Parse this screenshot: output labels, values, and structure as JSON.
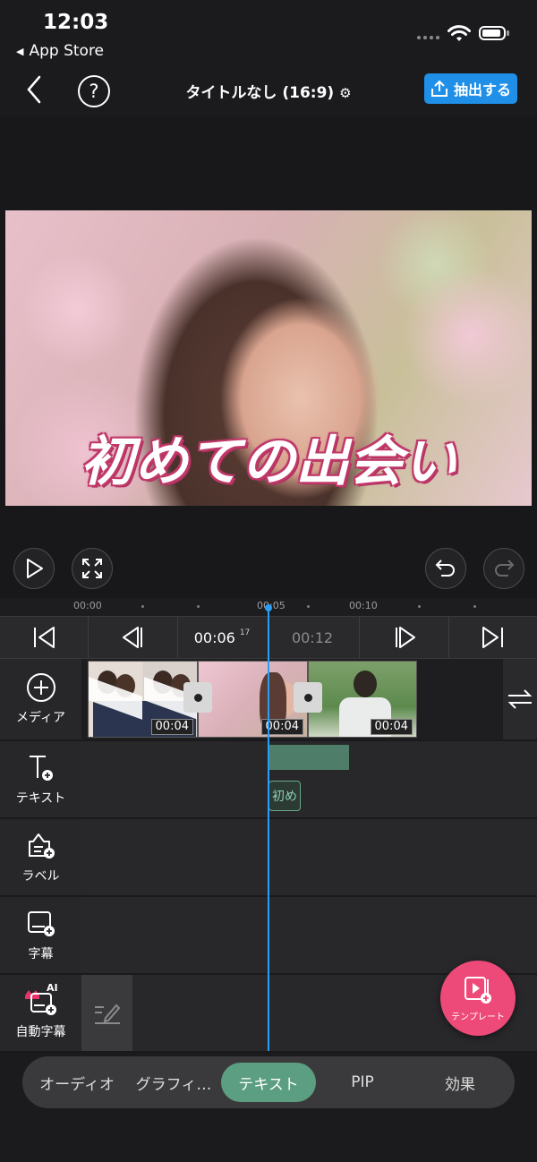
{
  "status_bar": {
    "time": "12:03",
    "back_app": "App Store"
  },
  "nav": {
    "project_title": "タイトルなし (16:9)",
    "export_label": "抽出する"
  },
  "preview": {
    "caption_text": "初めての出会い"
  },
  "ruler": {
    "ticks": [
      "00:00",
      "00:05",
      "00:10"
    ]
  },
  "transport": {
    "current_time": "00:06",
    "current_frames": "17",
    "next_time": "00:12"
  },
  "tracks": {
    "media": {
      "label": "メディア",
      "clip_durations": [
        "00:04",
        "00:04",
        "00:04"
      ]
    },
    "text": {
      "label": "テキスト",
      "item_label": "初め"
    },
    "label": {
      "label": "ラベル"
    },
    "subtitle": {
      "label": "字幕"
    },
    "auto_subtitle": {
      "label": "自動字幕",
      "badge": "AI"
    }
  },
  "template_button": {
    "label": "テンプレート"
  },
  "bottom_tabs": [
    {
      "label": "オーディオ"
    },
    {
      "label": "グラフィ…"
    },
    {
      "label": "テキスト"
    },
    {
      "label": "PIP"
    },
    {
      "label": "効果"
    }
  ],
  "colors": {
    "accent": "#1f8fe8",
    "active_tab": "#5b9e82",
    "playhead": "#2a9df4",
    "fab": "#ee4a79",
    "text_clip": "#4e7e6a"
  }
}
